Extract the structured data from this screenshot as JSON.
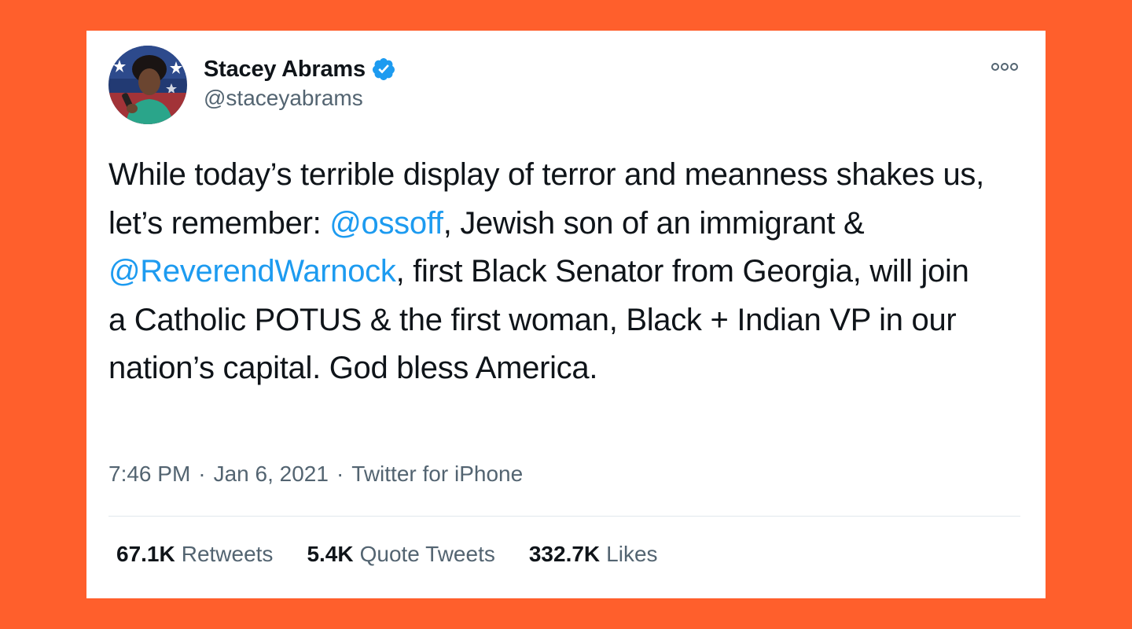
{
  "tweet": {
    "author": {
      "display_name": "Stacey Abrams",
      "handle": "@staceyabrams",
      "verified": true,
      "avatar_icon": "avatar-photo-icon"
    },
    "text_segments": [
      {
        "type": "text",
        "value": "While today’s terrible display of terror and meanness shakes us, let’s remember: "
      },
      {
        "type": "mention",
        "value": "@ossoff"
      },
      {
        "type": "text",
        "value": ", Jewish son of an immigrant & "
      },
      {
        "type": "mention",
        "value": "@ReverendWarnock"
      },
      {
        "type": "text",
        "value": ", first Black Senator from Georgia, will join a Catholic POTUS & the first woman, Black + Indian VP in our nation’s capital. God bless America."
      }
    ],
    "time": "7:46 PM",
    "date": "Jan 6, 2021",
    "separator": "·",
    "source": "Twitter for iPhone",
    "stats": {
      "retweets_count": "67.1K",
      "retweets_label": "Retweets",
      "quotes_count": "5.4K",
      "quotes_label": "Quote Tweets",
      "likes_count": "332.7K",
      "likes_label": "Likes"
    }
  },
  "colors": {
    "background": "#FF5F2C",
    "card": "#ffffff",
    "text": "#0f1419",
    "muted": "#536471",
    "link": "#1d9bf0",
    "verified": "#1d9bf0"
  }
}
